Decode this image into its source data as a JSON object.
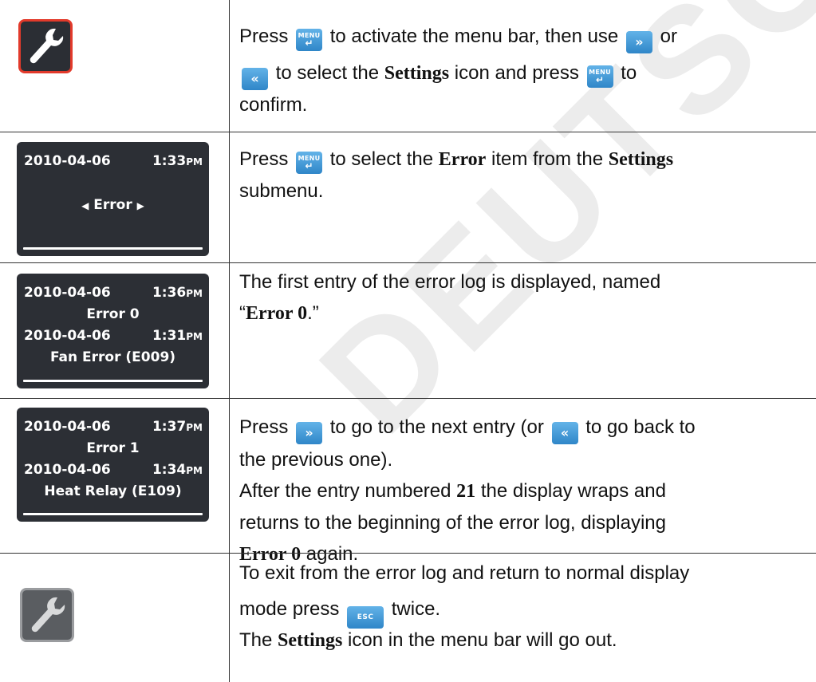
{
  "watermark": "DEUTSCHER",
  "keys": {
    "menu": "MENU",
    "menu_return": "↵",
    "next": "»",
    "prev": "«",
    "esc": "ESC"
  },
  "rows": [
    {
      "icon": "wrench-icon-active",
      "text": [
        "Press",
        "to activate the menu bar, then use",
        "or",
        "to select the",
        "Settings",
        "icon and press",
        "to",
        "confirm."
      ]
    },
    {
      "display": {
        "date": "2010-04-06",
        "time": "1:33",
        "ampm": "PM",
        "item": "Error",
        "left_arrow": "◀",
        "right_arrow": "▶"
      },
      "text": [
        "Press",
        "to select the",
        "Error",
        "item from the",
        "Settings",
        "submenu."
      ]
    },
    {
      "display": {
        "date1": "2010-04-06",
        "time1": "1:36",
        "ampm1": "PM",
        "name": "Error 0",
        "date2": "2010-04-06",
        "time2": "1:31",
        "ampm2": "PM",
        "error": "Fan Error (E009)"
      },
      "text": [
        "The first entry of the error log is displayed, named",
        "“",
        "Error 0",
        ".”"
      ]
    },
    {
      "display": {
        "date1": "2010-04-06",
        "time1": "1:37",
        "ampm1": "PM",
        "name": "Error 1",
        "date2": "2010-04-06",
        "time2": "1:34",
        "ampm2": "PM",
        "error": "Heat Relay (E109)"
      },
      "text": [
        "Press",
        "to go to the next entry (or",
        "to go back to",
        "the previous one).",
        "After the entry numbered",
        "21",
        "the display wraps and",
        "returns to the beginning of the error log, displaying",
        "Error 0",
        "again."
      ]
    },
    {
      "icon": "wrench-icon-inactive",
      "text": [
        "To exit from the error log and return to normal display",
        "mode press",
        "twice.",
        "The",
        "Settings",
        "icon in the menu bar will go out."
      ]
    }
  ]
}
